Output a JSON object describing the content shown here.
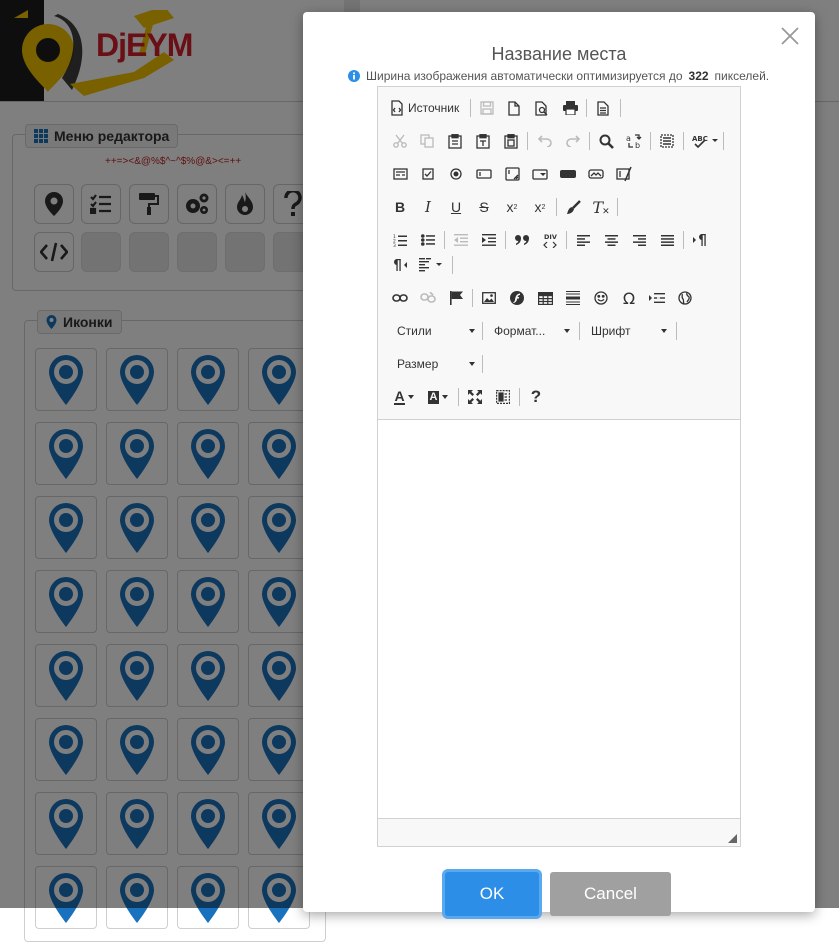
{
  "header": {
    "logo_text": "DjEYM"
  },
  "editor_menu": {
    "legend": "Меню редактора",
    "code_line": "++=><&@%$^~^$%@&><=++",
    "tools_row1": [
      "map-pin-icon",
      "checklist-icon",
      "paint-roller-icon",
      "cogs-icon",
      "fire-icon",
      "question-icon"
    ],
    "tools_row2": [
      "code-icon",
      "",
      "",
      "",
      "",
      ""
    ]
  },
  "icons_panel": {
    "legend": "Иконки",
    "icons": [
      "airplane-icon",
      "ferris-wheel-icon",
      "car-icon",
      "cocktail-icon",
      "swimming-icon",
      "bicycle-icon",
      "book-icon",
      "high-heel-icon",
      "taxi-icon",
      "cross-icon",
      "video-camera-icon",
      "circus-icon",
      "coffee-icon",
      "auction-icon",
      "boat-icon",
      "dog-icon",
      "graduation-cap-icon",
      "target-icon",
      "factory-icon",
      "family-icon",
      "t-shirt-icon",
      "bath-icon",
      "restaurant-icon",
      "gas-station-icon",
      "leaf-icon",
      "bus-stop-icon",
      "home-icon",
      "hospital-icon",
      "fountain-icon",
      "washing-machine-icon",
      "bank-icon",
      "law-icon"
    ],
    "pin_color": "#1a72bf"
  },
  "dialog": {
    "title": "Название места",
    "info_prefix": "Ширина изображения автоматически оптимизируется до",
    "info_value": "322",
    "info_suffix": "пикселей.",
    "ok_label": "OK",
    "cancel_label": "Cancel",
    "accent": "#2d8ee8"
  },
  "editor": {
    "source_label": "Источник",
    "combo_styles": "Стили",
    "combo_format": "Формат...",
    "combo_font": "Шрифт",
    "combo_size": "Размер",
    "bold": "B",
    "italic": "I",
    "underline": "U",
    "strike": "S",
    "subscript": "x",
    "superscript": "x",
    "remove_format": "T",
    "text_color": "A",
    "bg_color": "A",
    "help": "?",
    "omega": "Ω"
  }
}
